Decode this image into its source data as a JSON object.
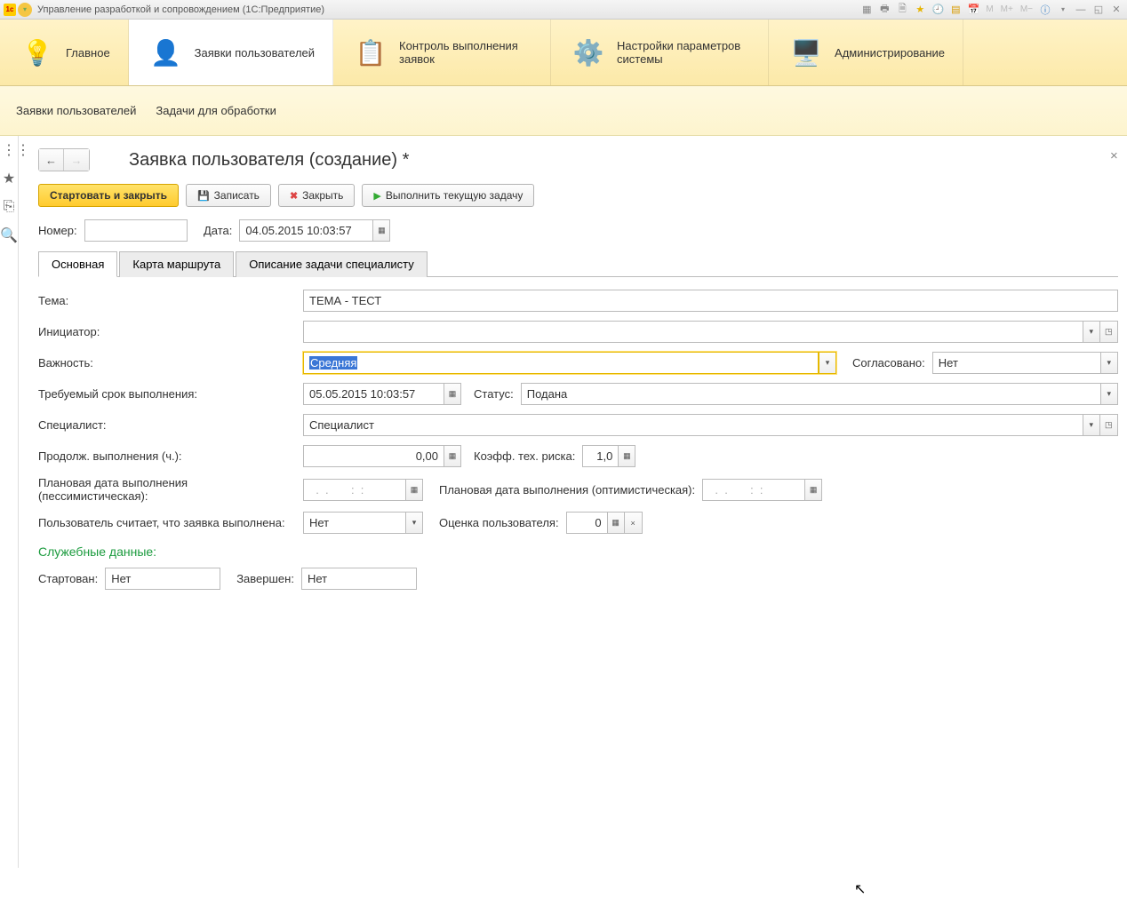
{
  "titlebar": {
    "title": "Управление разработкой и сопровождением  (1С:Предприятие)",
    "m": "M",
    "mplus": "M+",
    "mminus": "M−"
  },
  "nav": {
    "items": [
      {
        "label": "Главное"
      },
      {
        "label": "Заявки пользователей"
      },
      {
        "label": "Контроль выполнения заявок"
      },
      {
        "label": "Настройки параметров системы"
      },
      {
        "label": "Администрирование"
      }
    ]
  },
  "subnav": {
    "items": [
      {
        "label": "Заявки пользователей"
      },
      {
        "label": "Задачи для обработки"
      }
    ]
  },
  "page": {
    "title": "Заявка пользователя (создание) *"
  },
  "toolbar": {
    "start_close": "Стартовать и закрыть",
    "save": "Записать",
    "close": "Закрыть",
    "run_task": "Выполнить текущую задачу"
  },
  "numrow": {
    "num_label": "Номер:",
    "num_value": "",
    "date_label": "Дата:",
    "date_value": "04.05.2015 10:03:57"
  },
  "tabs": [
    {
      "label": "Основная"
    },
    {
      "label": "Карта маршрута"
    },
    {
      "label": "Описание задачи специалисту"
    }
  ],
  "form": {
    "theme_label": "Тема:",
    "theme_value": "ТЕМА - ТЕСТ",
    "initiator_label": "Инициатор:",
    "initiator_value": "",
    "priority_label": "Важность:",
    "priority_value": "Средняя",
    "agreed_label": "Согласовано:",
    "agreed_value": "Нет",
    "due_label": "Требуемый срок выполнения:",
    "due_value": "05.05.2015 10:03:57",
    "status_label": "Статус:",
    "status_value": "Подана",
    "specialist_label": "Специалист:",
    "specialist_value": "Специалист",
    "duration_label": "Продолж. выполнения (ч.):",
    "duration_value": "0,00",
    "risk_label": "Коэфф. тех. риска:",
    "risk_value": "1,0",
    "plan_pess_label": "Плановая дата выполнения (пессимистическая):",
    "plan_pess_value": "  .  .       :  :",
    "plan_opt_label": "Плановая дата выполнения (оптимистическая):",
    "plan_opt_value": "  .  .       :  :",
    "user_considers_label": "Пользователь считает, что заявка выполнена:",
    "user_considers_value": "Нет",
    "user_rating_label": "Оценка пользователя:",
    "user_rating_value": "0",
    "service_header": "Служебные данные:",
    "started_label": "Стартован:",
    "started_value": "Нет",
    "finished_label": "Завершен:",
    "finished_value": "Нет"
  }
}
